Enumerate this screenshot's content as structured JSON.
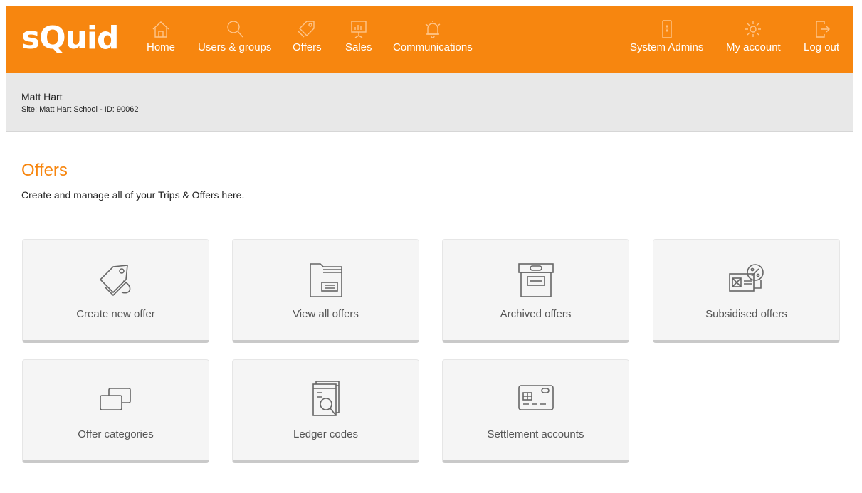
{
  "brand": {
    "logo": "sQuid",
    "color": "#f7860f"
  },
  "nav": {
    "left": [
      {
        "label": "Home",
        "icon": "home-icon"
      },
      {
        "label": "Users & groups",
        "icon": "search-icon"
      },
      {
        "label": "Offers",
        "icon": "tags-icon"
      },
      {
        "label": "Sales",
        "icon": "presentation-chart-icon"
      },
      {
        "label": "Communications",
        "icon": "bell-icon"
      }
    ],
    "right": [
      {
        "label": "System Admins",
        "icon": "phone-admin-icon"
      },
      {
        "label": "My account",
        "icon": "gear-icon"
      },
      {
        "label": "Log out",
        "icon": "logout-door-icon"
      }
    ]
  },
  "user": {
    "name": "Matt Hart",
    "site": "Site: Matt Hart School - ID: 90062"
  },
  "page": {
    "title": "Offers",
    "description": "Create and manage all of your Trips & Offers here."
  },
  "tiles": [
    {
      "label": "Create new offer",
      "icon": "tags-icon"
    },
    {
      "label": "View all offers",
      "icon": "folder-icon"
    },
    {
      "label": "Archived offers",
      "icon": "archive-box-icon"
    },
    {
      "label": "Subsidised offers",
      "icon": "discount-card-icon"
    },
    {
      "label": "Offer categories",
      "icon": "cards-stack-icon"
    },
    {
      "label": "Ledger codes",
      "icon": "ledger-search-icon"
    },
    {
      "label": "Settlement accounts",
      "icon": "credit-card-icon"
    }
  ]
}
